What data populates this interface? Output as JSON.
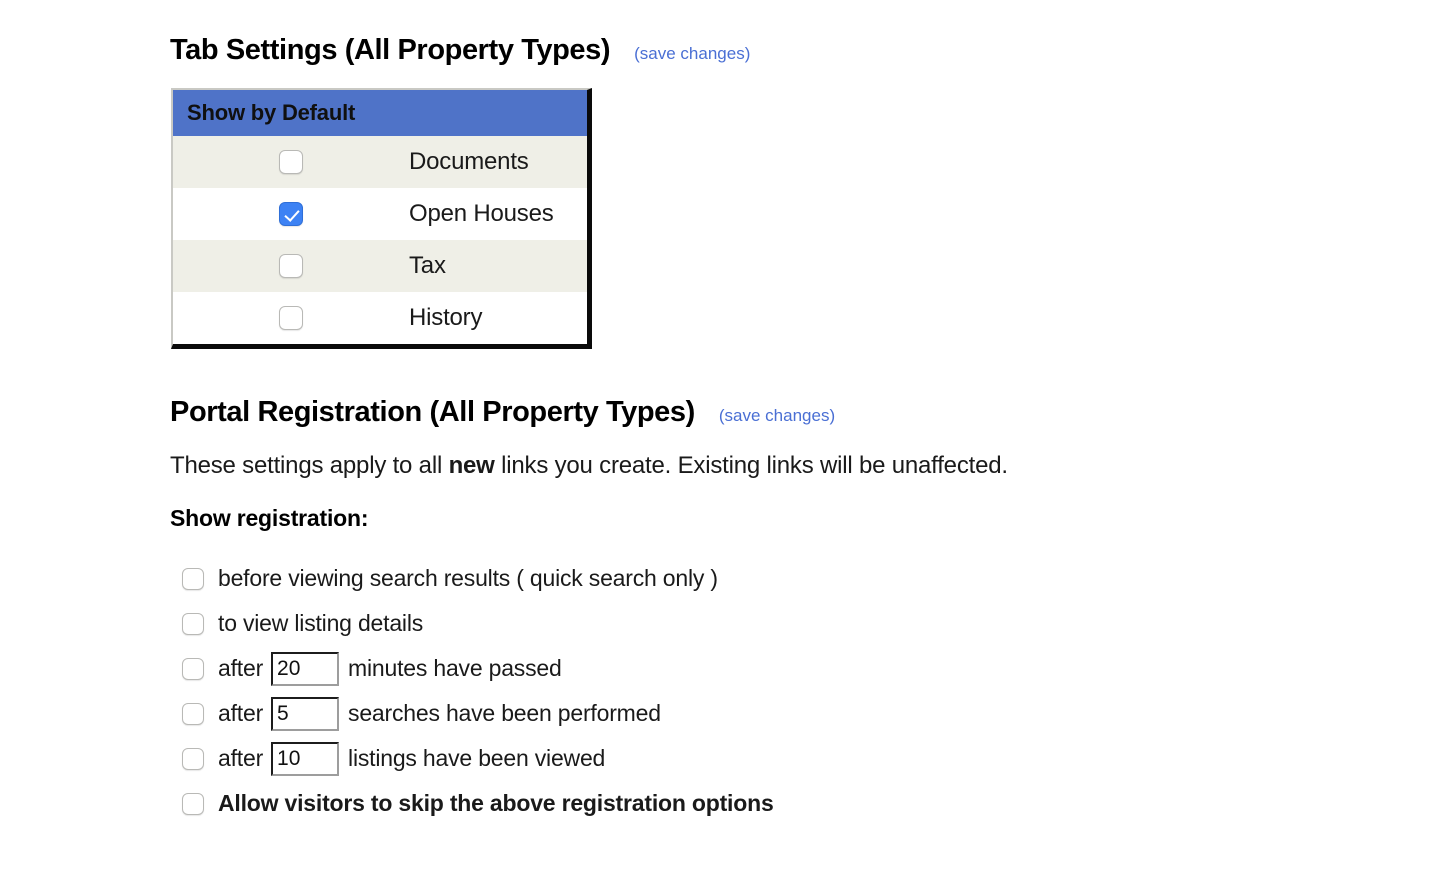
{
  "tab_settings": {
    "title": "Tab Settings (All Property Types)",
    "save_label": "(save changes)",
    "table": {
      "header": "Show by Default",
      "header_color": "#4f73c8",
      "alt_row_color": "#efefe7",
      "rows": [
        {
          "label": "Documents",
          "checked": false
        },
        {
          "label": "Open Houses",
          "checked": true
        },
        {
          "label": "Tax",
          "checked": false
        },
        {
          "label": "History",
          "checked": false
        }
      ]
    }
  },
  "portal_registration": {
    "title": "Portal Registration (All Property Types)",
    "save_label": "(save changes)",
    "intro": {
      "before": "These settings apply to all ",
      "emphasis": "new",
      "after": " links you create. Existing links will be unaffected."
    },
    "show_registration_label": "Show registration:",
    "options": [
      {
        "type": "text",
        "checked": false,
        "label": "before viewing search results ( quick search only )",
        "bold": false
      },
      {
        "type": "text",
        "checked": false,
        "label": "to view listing details",
        "bold": false
      },
      {
        "type": "input",
        "checked": false,
        "prefix": "after",
        "value": "20",
        "suffix": "minutes have passed"
      },
      {
        "type": "input",
        "checked": false,
        "prefix": "after",
        "value": "5",
        "suffix": "searches have been performed"
      },
      {
        "type": "input",
        "checked": false,
        "prefix": "after",
        "value": "10",
        "suffix": "listings have been viewed"
      },
      {
        "type": "text",
        "checked": false,
        "label": "Allow visitors to skip the above registration options",
        "bold": true
      }
    ]
  },
  "colors": {
    "link": "#4a6fd4",
    "header_blue": "#4f73c8",
    "checkbox_blue": "#3d82f4",
    "row_stripe": "#efefe7"
  }
}
